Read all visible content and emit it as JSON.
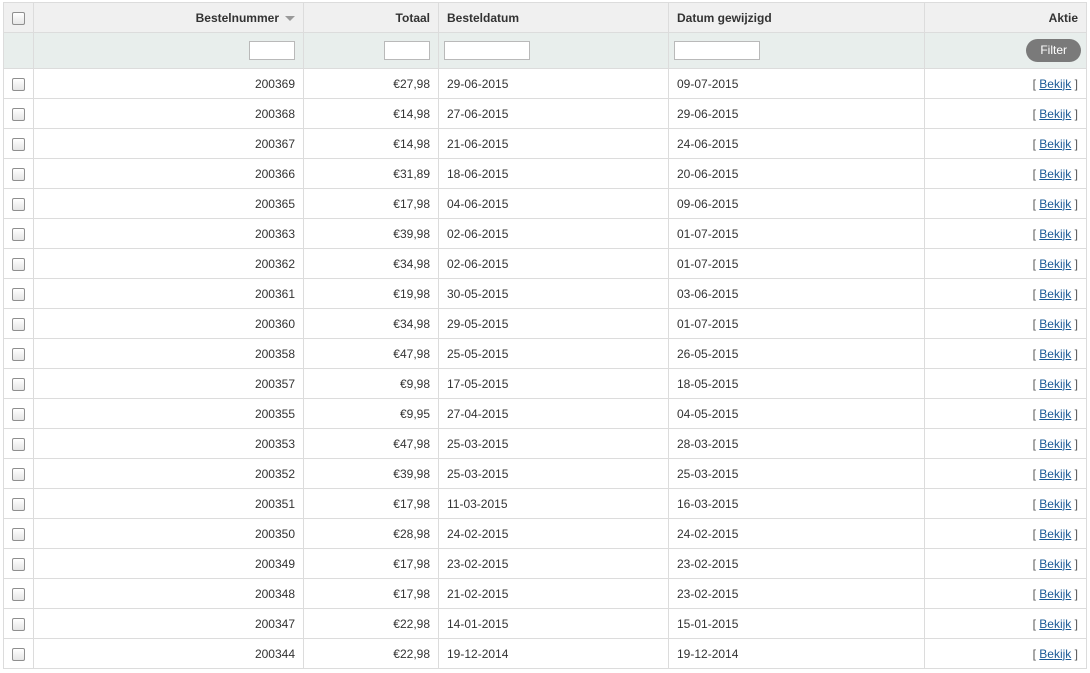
{
  "columns": {
    "order_number": "Bestelnummer",
    "total": "Totaal",
    "order_date": "Besteldatum",
    "date_modified": "Datum gewijzigd",
    "action": "Aktie"
  },
  "filter_button_label": "Filter",
  "action_open": "[",
  "action_close": "]",
  "rows": [
    {
      "order": "200369",
      "total": "€27,98",
      "date": "29-06-2015",
      "modified": "09-07-2015",
      "action": "Bekijk"
    },
    {
      "order": "200368",
      "total": "€14,98",
      "date": "27-06-2015",
      "modified": "29-06-2015",
      "action": "Bekijk"
    },
    {
      "order": "200367",
      "total": "€14,98",
      "date": "21-06-2015",
      "modified": "24-06-2015",
      "action": "Bekijk"
    },
    {
      "order": "200366",
      "total": "€31,89",
      "date": "18-06-2015",
      "modified": "20-06-2015",
      "action": "Bekijk"
    },
    {
      "order": "200365",
      "total": "€17,98",
      "date": "04-06-2015",
      "modified": "09-06-2015",
      "action": "Bekijk"
    },
    {
      "order": "200363",
      "total": "€39,98",
      "date": "02-06-2015",
      "modified": "01-07-2015",
      "action": "Bekijk"
    },
    {
      "order": "200362",
      "total": "€34,98",
      "date": "02-06-2015",
      "modified": "01-07-2015",
      "action": "Bekijk"
    },
    {
      "order": "200361",
      "total": "€19,98",
      "date": "30-05-2015",
      "modified": "03-06-2015",
      "action": "Bekijk"
    },
    {
      "order": "200360",
      "total": "€34,98",
      "date": "29-05-2015",
      "modified": "01-07-2015",
      "action": "Bekijk"
    },
    {
      "order": "200358",
      "total": "€47,98",
      "date": "25-05-2015",
      "modified": "26-05-2015",
      "action": "Bekijk"
    },
    {
      "order": "200357",
      "total": "€9,98",
      "date": "17-05-2015",
      "modified": "18-05-2015",
      "action": "Bekijk"
    },
    {
      "order": "200355",
      "total": "€9,95",
      "date": "27-04-2015",
      "modified": "04-05-2015",
      "action": "Bekijk"
    },
    {
      "order": "200353",
      "total": "€47,98",
      "date": "25-03-2015",
      "modified": "28-03-2015",
      "action": "Bekijk"
    },
    {
      "order": "200352",
      "total": "€39,98",
      "date": "25-03-2015",
      "modified": "25-03-2015",
      "action": "Bekijk"
    },
    {
      "order": "200351",
      "total": "€17,98",
      "date": "11-03-2015",
      "modified": "16-03-2015",
      "action": "Bekijk"
    },
    {
      "order": "200350",
      "total": "€28,98",
      "date": "24-02-2015",
      "modified": "24-02-2015",
      "action": "Bekijk"
    },
    {
      "order": "200349",
      "total": "€17,98",
      "date": "23-02-2015",
      "modified": "23-02-2015",
      "action": "Bekijk"
    },
    {
      "order": "200348",
      "total": "€17,98",
      "date": "21-02-2015",
      "modified": "23-02-2015",
      "action": "Bekijk"
    },
    {
      "order": "200347",
      "total": "€22,98",
      "date": "14-01-2015",
      "modified": "15-01-2015",
      "action": "Bekijk"
    },
    {
      "order": "200344",
      "total": "€22,98",
      "date": "19-12-2014",
      "modified": "19-12-2014",
      "action": "Bekijk"
    }
  ]
}
